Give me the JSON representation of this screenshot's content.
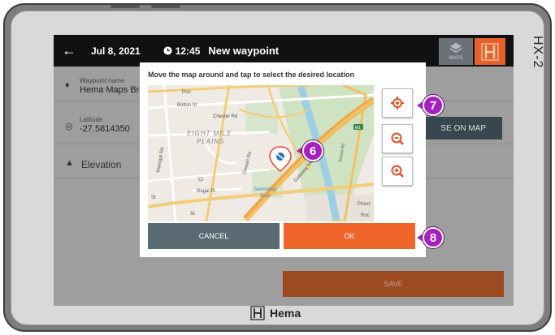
{
  "device": {
    "model": "HX-2",
    "brand": "Hema"
  },
  "topbar": {
    "date": "Jul 8, 2021",
    "time": "12:45",
    "title": "New waypoint",
    "maps_label": "MAPS"
  },
  "form": {
    "waypoint_name_label": "Waypoint name",
    "waypoint_name_value": "Hema Maps Bris",
    "latitude_label": "Latitude",
    "latitude_value": "-27.5814350",
    "use_on_map_label": "SE ON MAP",
    "elevation_label": "Elevation",
    "save_label": "SAVE"
  },
  "dialog": {
    "title": "Move the map around and tap to select the desired location",
    "cancel_label": "CANCEL",
    "ok_label": "OK"
  },
  "map": {
    "labels": {
      "poo": "Poo",
      "bolton": "Bolton St",
      "chester": "Chester Rd",
      "eight_mile": "EIGHT MILE",
      "plains": "PLAINS",
      "warrigal": "Warrigal Rd",
      "gowan": "Gowan Rd",
      "regal": "Regal Pl",
      "swimming": "Swimming",
      "pool": "Pool",
      "gateway": "Gateway Mwy",
      "priest": "Priest",
      "roc": "Roc",
      "m1": "M1",
      "st1": "St",
      "st2": "St",
      "school": "School Rd",
      "ct": "Ct"
    }
  },
  "callouts": {
    "c6": "6",
    "c7": "7",
    "c8": "8"
  }
}
